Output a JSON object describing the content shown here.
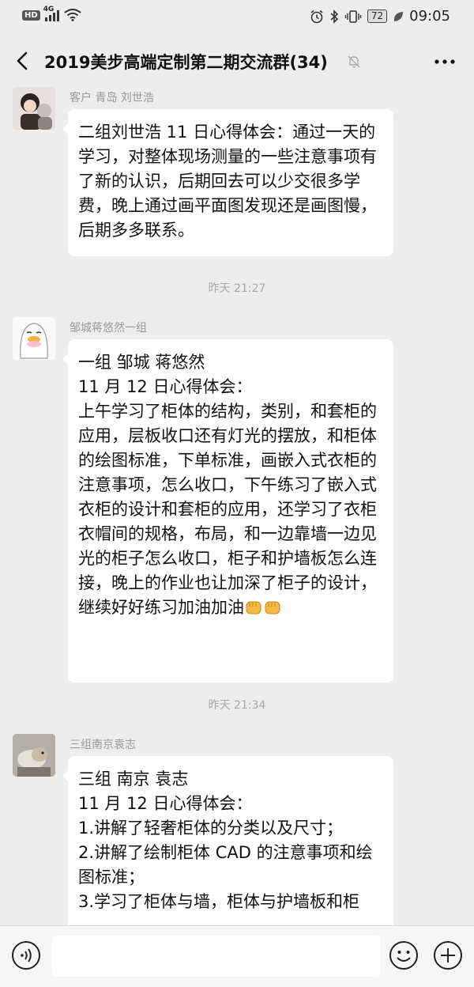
{
  "status_bar": {
    "hd": "HD",
    "network": "4G",
    "battery": "72",
    "time": "09:05"
  },
  "nav": {
    "title": "2019美步高端定制第二期交流群(34)"
  },
  "messages": [
    {
      "sender": "客户 青岛 刘世浩",
      "text": "二组刘世浩 11 日心得体会：通过一天的学习，对整体现场测量的一些注意事项有了新的认识，后期回去可以少交很多学费，晚上通过画平面图发现还是画图慢，后期多多联系。"
    },
    {
      "timestamp": "昨天 21:27"
    },
    {
      "sender": "邹城蒋悠然一组",
      "text": "一组 邹城 蒋悠然\n11 月 12 日心得体会：\n上午学习了柜体的结构，类别，和套柜的应用，层板收口还有灯光的摆放，和柜体的绘图标准，下单标准，画嵌入式衣柜的注意事项，怎么收口，下午练习了嵌入式衣柜的设计和套柜的应用，还学习了衣柜衣帽间的规格，布局，和一边靠墙一边见光的柜子怎么收口，柜子和护墙板怎么连接，晚上的作业也让加深了柜子的设计，继续好好练习加油加油"
    },
    {
      "timestamp": "昨天 21:34"
    },
    {
      "sender": "三组南京袁志",
      "text": "三组 南京 袁志\n11 月 12 日心得体会：\n1.讲解了轻奢柜体的分类以及尺寸；\n2.讲解了绘制柜体 CAD 的注意事项和绘图标准；\n3.学习了柜体与墙，柜体与护墙板和柜"
    }
  ],
  "icons": {
    "back": "chevron-left-icon",
    "mute": "bell-mute-icon",
    "more": "more-dots-icon",
    "voice": "voice-icon",
    "emoji": "smile-icon",
    "plus": "plus-icon",
    "fist": "fist-emoji"
  }
}
